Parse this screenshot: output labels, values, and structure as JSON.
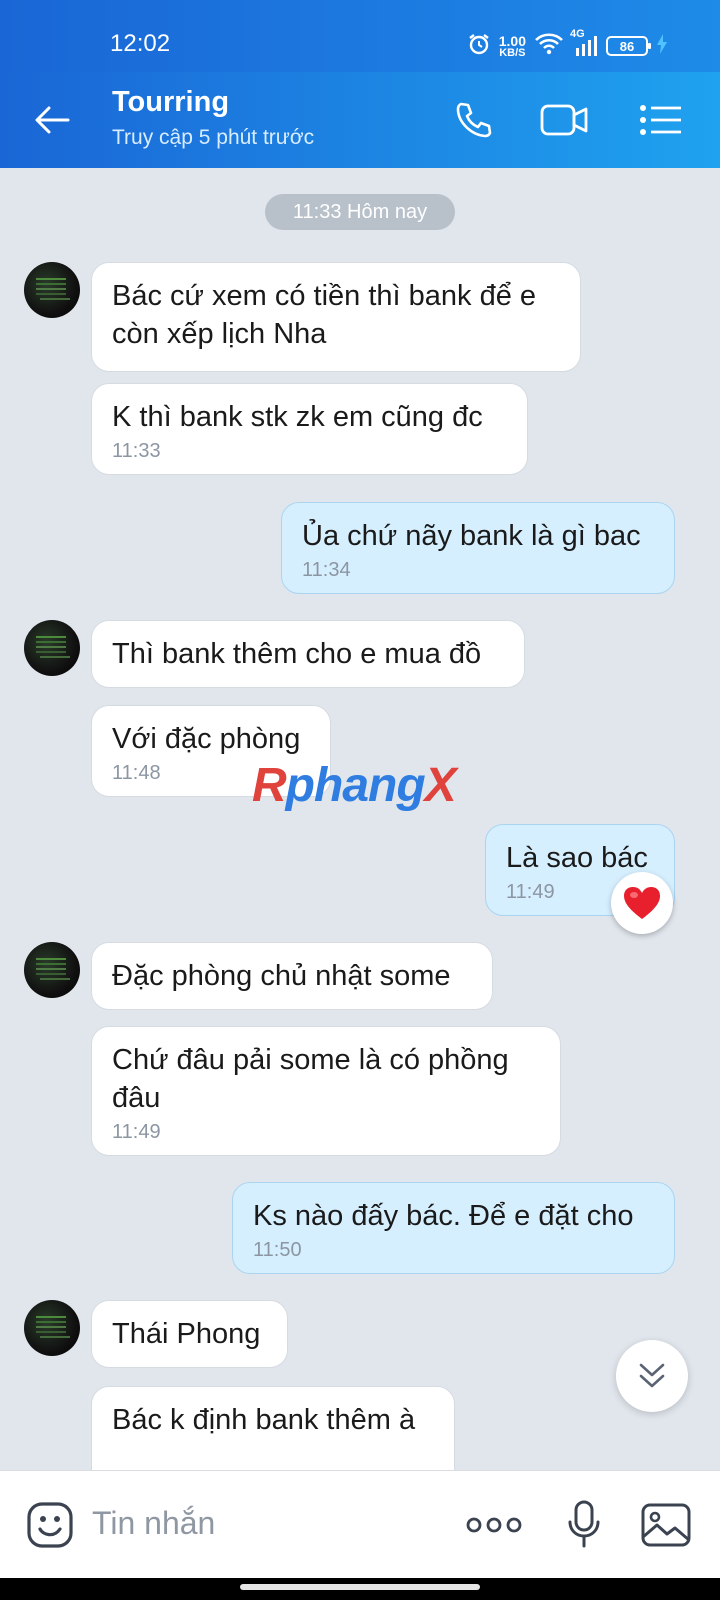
{
  "status_bar": {
    "time": "12:02",
    "net_speed_value": "1.00",
    "net_speed_unit": "KB/S",
    "network_type": "4G",
    "battery": "86",
    "icons": [
      "alarm-icon",
      "wifi-icon",
      "signal-icon",
      "battery-icon",
      "charging-icon"
    ]
  },
  "header": {
    "title": "Tourring",
    "subtitle": "Truy cập 5 phút trước",
    "icons": [
      "back-arrow-icon",
      "phone-icon",
      "video-call-icon",
      "menu-list-icon"
    ]
  },
  "chat": {
    "date_separator": "11:33 Hôm nay",
    "messages": [
      {
        "dir": "in",
        "text": "Bác cứ xem có tiền thì bank để e\ncòn xếp lịch Nha",
        "time": ""
      },
      {
        "dir": "in",
        "text": "K thì bank stk zk em cũng đc",
        "time": "11:33"
      },
      {
        "dir": "out",
        "text": "Ủa chứ nãy bank là gì bac",
        "time": "11:34"
      },
      {
        "dir": "in",
        "text": "Thì bank thêm cho e mua đồ",
        "time": ""
      },
      {
        "dir": "in",
        "text": "Với đặc phòng",
        "time": "11:48"
      },
      {
        "dir": "out",
        "text": "Là sao bác",
        "time": "11:49",
        "reaction": "heart"
      },
      {
        "dir": "in",
        "text": "Đặc phòng chủ nhật some",
        "time": ""
      },
      {
        "dir": "in",
        "text": "Chứ đâu pải some là có phồng\nđâu",
        "time": "11:49"
      },
      {
        "dir": "out",
        "text": "Ks nào đấy bác. Để e đặt cho",
        "time": "11:50"
      },
      {
        "dir": "in",
        "text": "Thái Phong",
        "time": ""
      },
      {
        "dir": "in",
        "text": "Bác k định bank thêm à",
        "time": ""
      }
    ],
    "watermark": {
      "part1": "R",
      "part2": "phang",
      "part3": "X"
    }
  },
  "input_bar": {
    "placeholder": "Tin nhắn",
    "icons": [
      "emoji-sticker-icon",
      "more-options-icon",
      "microphone-icon",
      "image-gallery-icon"
    ]
  },
  "colors": {
    "header_start": "#1a66d6",
    "header_end": "#1fa2ef",
    "chat_bg": "#e1e6ed",
    "outgoing_bubble": "#d6efff",
    "incoming_bubble": "#ffffff"
  }
}
